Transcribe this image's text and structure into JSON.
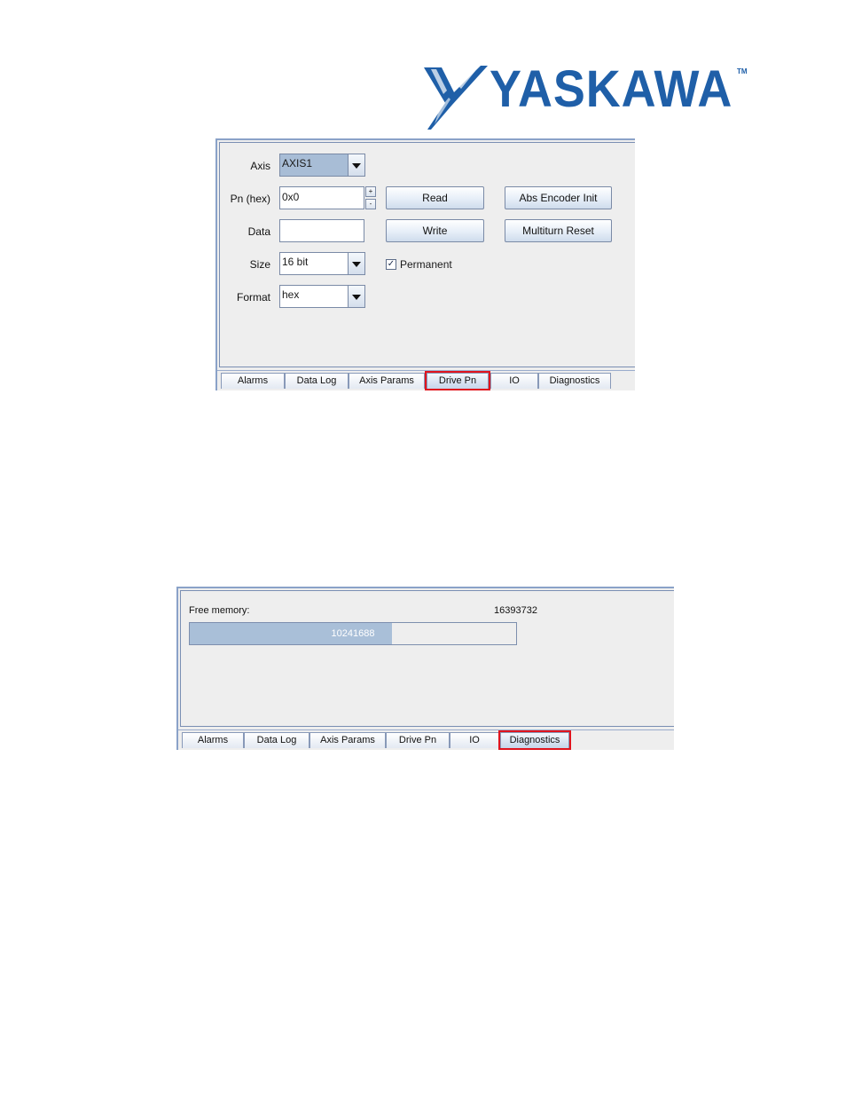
{
  "logo": {
    "text": "YASKAWA",
    "tm": "TM",
    "color": "#1f5fa8"
  },
  "drive_panel": {
    "axis": {
      "label": "Axis",
      "value": "AXIS1"
    },
    "pn": {
      "label": "Pn (hex)",
      "value": "0x0",
      "up": "+",
      "down": "-"
    },
    "data": {
      "label": "Data",
      "value": ""
    },
    "size": {
      "label": "Size",
      "value": "16 bit"
    },
    "format": {
      "label": "Format",
      "value": "hex"
    },
    "buttons": {
      "read": "Read",
      "write": "Write",
      "abs_encoder_init": "Abs Encoder Init",
      "multiturn_reset": "Multiturn Reset"
    },
    "permanent": {
      "label": "Permanent",
      "checked": true,
      "mark": "✓"
    }
  },
  "tabs": [
    "Alarms",
    "Data Log",
    "Axis Params",
    "Drive Pn",
    "IO",
    "Diagnostics"
  ],
  "diagnostics_panel": {
    "free_memory_label": "Free memory:",
    "total_memory": "16393732",
    "used_memory": "10241688",
    "fill_fraction": 0.62
  },
  "colors": {
    "highlight": "#e0141e",
    "panel_bg": "#eeeeee",
    "progress_fill": "#a9bfd8"
  }
}
